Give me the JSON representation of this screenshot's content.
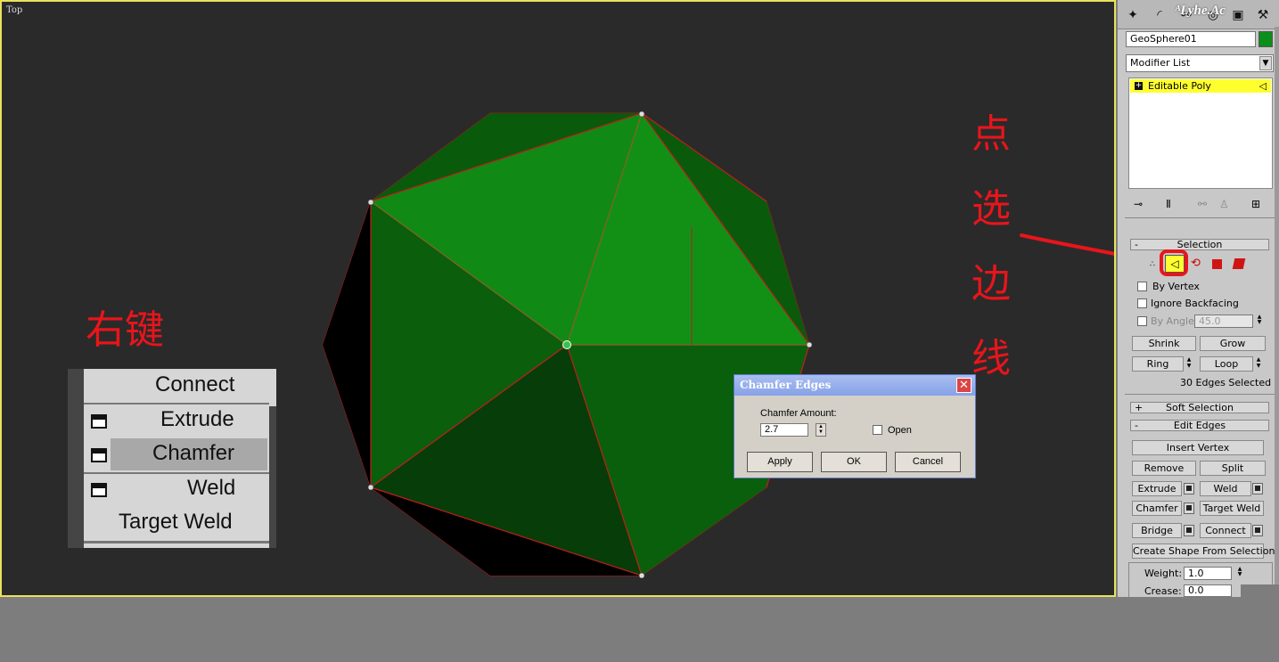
{
  "viewport": {
    "label": "Top"
  },
  "panel": {
    "watermark": "ᴬLyhe.Ac",
    "object_name": "GeoSphere01",
    "object_color": "#0b8f1a",
    "modifier_list": "Modifier List",
    "stack_item": "Editable Poly",
    "rollouts": {
      "selection": "Selection",
      "soft_selection": "Soft Selection",
      "edit_edges": "Edit Edges"
    },
    "selection": {
      "by_vertex": "By Vertex",
      "ignore_backfacing": "Ignore Backfacing",
      "by_angle": "By Angle:",
      "angle_value": "45.0",
      "shrink": "Shrink",
      "grow": "Grow",
      "ring": "Ring",
      "loop": "Loop",
      "status": "30 Edges Selected"
    },
    "edit_edges": {
      "insert_vertex": "Insert Vertex",
      "remove": "Remove",
      "split": "Split",
      "extrude": "Extrude",
      "weld": "Weld",
      "chamfer": "Chamfer",
      "target_weld": "Target Weld",
      "bridge": "Bridge",
      "connect": "Connect",
      "create_shape": "Create Shape From Selection",
      "weight_label": "Weight:",
      "weight_value": "1.0",
      "crease_label": "Crease:",
      "crease_value": "0.0"
    }
  },
  "context_menu": {
    "items": [
      "Connect",
      "Extrude",
      "Chamfer",
      "Weld",
      "Target Weld"
    ]
  },
  "dialog": {
    "title": "Chamfer Edges",
    "amount_label": "Chamfer Amount:",
    "amount_value": "2.7",
    "open_label": "Open",
    "apply": "Apply",
    "ok": "OK",
    "cancel": "Cancel"
  },
  "annotations": {
    "right_click": "右键",
    "pick_edge": [
      "点",
      "选",
      "边",
      "线"
    ]
  },
  "colors": {
    "annotation_red": "#e8151b",
    "face_light": "#108a14",
    "face_mid": "#0a5e0c",
    "face_dark": "#073d08",
    "edge_red": "#c21d1d",
    "selected_yellow": "#ffff30"
  }
}
